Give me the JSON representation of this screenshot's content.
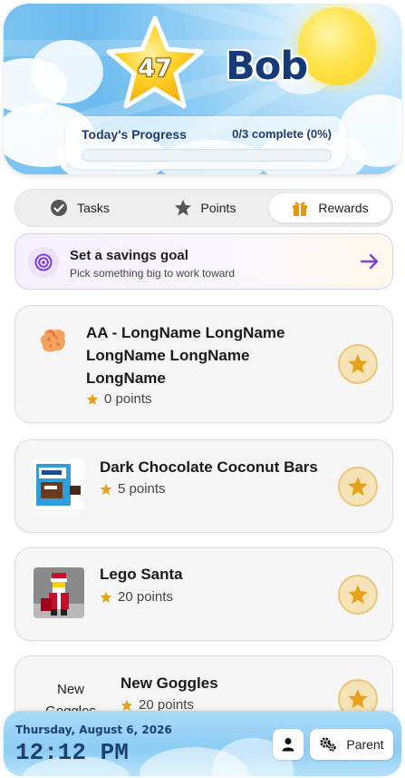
{
  "header": {
    "points_total": "47",
    "kid_name": "Bob",
    "progress_title": "Today's Progress",
    "progress_count": "0/3 complete (0%)",
    "progress_fraction": 0
  },
  "tabs": [
    {
      "label": "Tasks",
      "icon": "check-circle-icon",
      "active": false
    },
    {
      "label": "Points",
      "icon": "star-icon",
      "active": false
    },
    {
      "label": "Rewards",
      "icon": "gift-icon",
      "active": true
    }
  ],
  "savings": {
    "title": "Set a savings goal",
    "subtitle": "Pick something big to work toward",
    "icon": "target-icon",
    "accent": "#7b3fe4"
  },
  "rewards": [
    {
      "title_lines": [
        "AA - LongName LongName",
        "LongName LongName",
        "LongName"
      ],
      "points": "0 points",
      "image": "sponge-icon"
    },
    {
      "title_lines": [
        "Dark Chocolate Coconut Bars"
      ],
      "points": "5 points",
      "image": "product-box-image"
    },
    {
      "title_lines": [
        "Lego Santa"
      ],
      "points": "20 points",
      "image": "lego-santa-image"
    },
    {
      "title_lines": [
        "New Goggles"
      ],
      "points": "20 points",
      "image_alt": "New Goggles"
    }
  ],
  "footer": {
    "date": "Thursday, August 6, 2026",
    "time": "12:12 PM",
    "parent_label": "Parent"
  },
  "colors": {
    "star_gold": "#e6a21a",
    "navy": "#1f3f74",
    "progress_green": "#4caf50"
  }
}
